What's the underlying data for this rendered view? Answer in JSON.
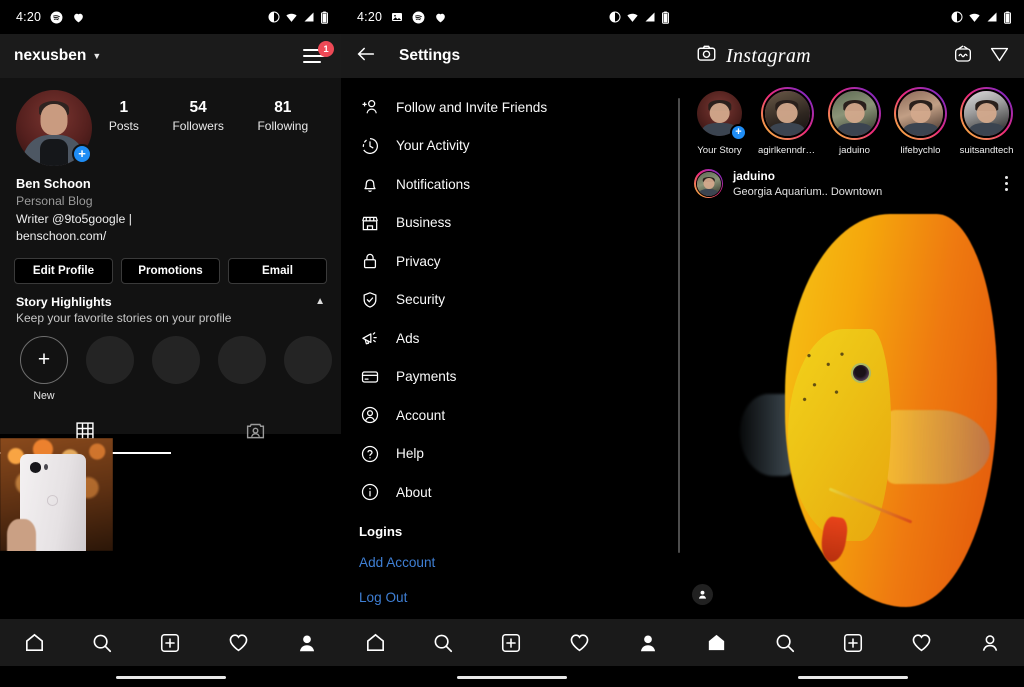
{
  "status_bar": {
    "time": "4:20",
    "left_icons": [
      "image-icon",
      "spotify-icon",
      "heart-icon"
    ],
    "right_icons": [
      "dnd-icon",
      "wifi-icon",
      "signal-icon",
      "battery-icon"
    ]
  },
  "profile_screen": {
    "header": {
      "username": "nexusben",
      "menu_badge": "1"
    },
    "stats": [
      {
        "value": "1",
        "label": "Posts"
      },
      {
        "value": "54",
        "label": "Followers"
      },
      {
        "value": "81",
        "label": "Following"
      }
    ],
    "bio": {
      "name": "Ben Schoon",
      "category": "Personal Blog",
      "line1": "Writer @9to5google |",
      "line2": "benschoon.com/"
    },
    "buttons": [
      {
        "label": "Edit Profile"
      },
      {
        "label": "Promotions"
      },
      {
        "label": "Email"
      }
    ],
    "highlights": {
      "title": "Story Highlights",
      "subtitle": "Keep your favorite stories on your profile",
      "new_label": "New",
      "empty_count": 4
    },
    "tabs": [
      {
        "name": "grid-tab",
        "icon": "grid-icon",
        "active": true
      },
      {
        "name": "tagged-tab",
        "icon": "tagged-person-icon",
        "active": false
      }
    ]
  },
  "settings_screen": {
    "title": "Settings",
    "back_icon": "arrow-left-icon",
    "items": [
      {
        "label": "Follow and Invite Friends",
        "icon": "add-person-icon"
      },
      {
        "label": "Your Activity",
        "icon": "clock-icon"
      },
      {
        "label": "Notifications",
        "icon": "bell-icon"
      },
      {
        "label": "Business",
        "icon": "storefront-icon"
      },
      {
        "label": "Privacy",
        "icon": "lock-icon"
      },
      {
        "label": "Security",
        "icon": "shield-check-icon"
      },
      {
        "label": "Ads",
        "icon": "megaphone-icon"
      },
      {
        "label": "Payments",
        "icon": "credit-card-icon"
      },
      {
        "label": "Account",
        "icon": "person-circle-icon"
      },
      {
        "label": "Help",
        "icon": "question-circle-icon"
      },
      {
        "label": "About",
        "icon": "info-circle-icon"
      }
    ],
    "section_title": "Logins",
    "links": [
      {
        "label": "Add Account",
        "color": "#3f7fd4"
      },
      {
        "label": "Log Out",
        "color": "#3f7fd4"
      }
    ]
  },
  "feed_screen": {
    "app_title": "Instagram",
    "camera_icon": "camera-icon",
    "igtv_icon": "igtv-icon",
    "direct_icon": "paper-plane-icon",
    "stories": [
      {
        "label": "Your Story",
        "has_ring": false,
        "has_plus": true
      },
      {
        "label": "agirlkenndre...",
        "has_ring": true,
        "has_plus": false
      },
      {
        "label": "jaduino",
        "has_ring": true,
        "has_plus": false
      },
      {
        "label": "lifebychlo",
        "has_ring": true,
        "has_plus": false
      },
      {
        "label": "suitsandtech",
        "has_ring": true,
        "has_plus": false
      }
    ],
    "post": {
      "username": "jaduino",
      "location": "Georgia Aquarium.. Downtown",
      "menu_icon": "more-options-icon",
      "tag_icon": "tagged-people-icon",
      "actions": [
        "like-icon",
        "comment-icon",
        "share-icon",
        "bookmark-icon"
      ]
    }
  },
  "bottom_nav": {
    "items": [
      {
        "name": "nav-home",
        "icon": "home-icon"
      },
      {
        "name": "nav-search",
        "icon": "search-icon"
      },
      {
        "name": "nav-add",
        "icon": "plus-square-icon"
      },
      {
        "name": "nav-activity",
        "icon": "heart-icon"
      },
      {
        "name": "nav-profile",
        "icon": "person-icon"
      }
    ]
  },
  "colors": {
    "accent_blue": "#1f8df5",
    "link_blue": "#3f7fd4",
    "badge_red": "#ed4956",
    "bar_bg": "#1a1a1a",
    "page_bg": "#000000"
  }
}
